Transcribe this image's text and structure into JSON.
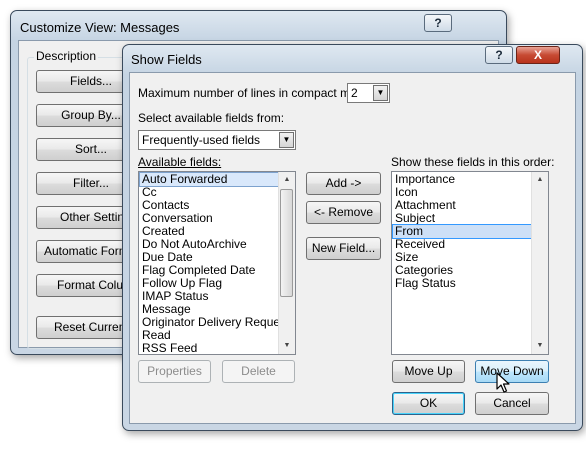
{
  "back_window": {
    "title": "Customize View: Messages",
    "help_button": "?",
    "group_label": "Description",
    "buttons": [
      "Fields...",
      "Group By...",
      "Sort...",
      "Filter...",
      "Other Settings...",
      "Automatic Formatting...",
      "Format Columns...",
      "Reset Current View"
    ]
  },
  "dialog": {
    "title": "Show Fields",
    "help_button": "?",
    "close_button": "X",
    "max_lines_label": "Maximum number of lines in compact mode:",
    "max_lines_value": "2",
    "select_from_label": "Select available fields from:",
    "select_from_value": "Frequently-used fields",
    "available_label": "Available fields:",
    "available_fields": [
      "Auto Forwarded",
      "Cc",
      "Contacts",
      "Conversation",
      "Created",
      "Do Not AutoArchive",
      "Due Date",
      "Flag Completed Date",
      "Follow Up Flag",
      "IMAP Status",
      "Message",
      "Originator Delivery Requeste",
      "Read",
      "RSS Feed"
    ],
    "show_label": "Show these fields in this order:",
    "shown_fields": [
      "Importance",
      "Icon",
      "Attachment",
      "Subject",
      "From",
      "Received",
      "Size",
      "Categories",
      "Flag Status"
    ],
    "buttons": {
      "add": "Add ->",
      "remove": "<- Remove",
      "new_field": "New Field...",
      "properties": "Properties",
      "delete": "Delete",
      "move_up": "Move Up",
      "move_down": "Move Down",
      "ok": "OK",
      "cancel": "Cancel"
    }
  }
}
